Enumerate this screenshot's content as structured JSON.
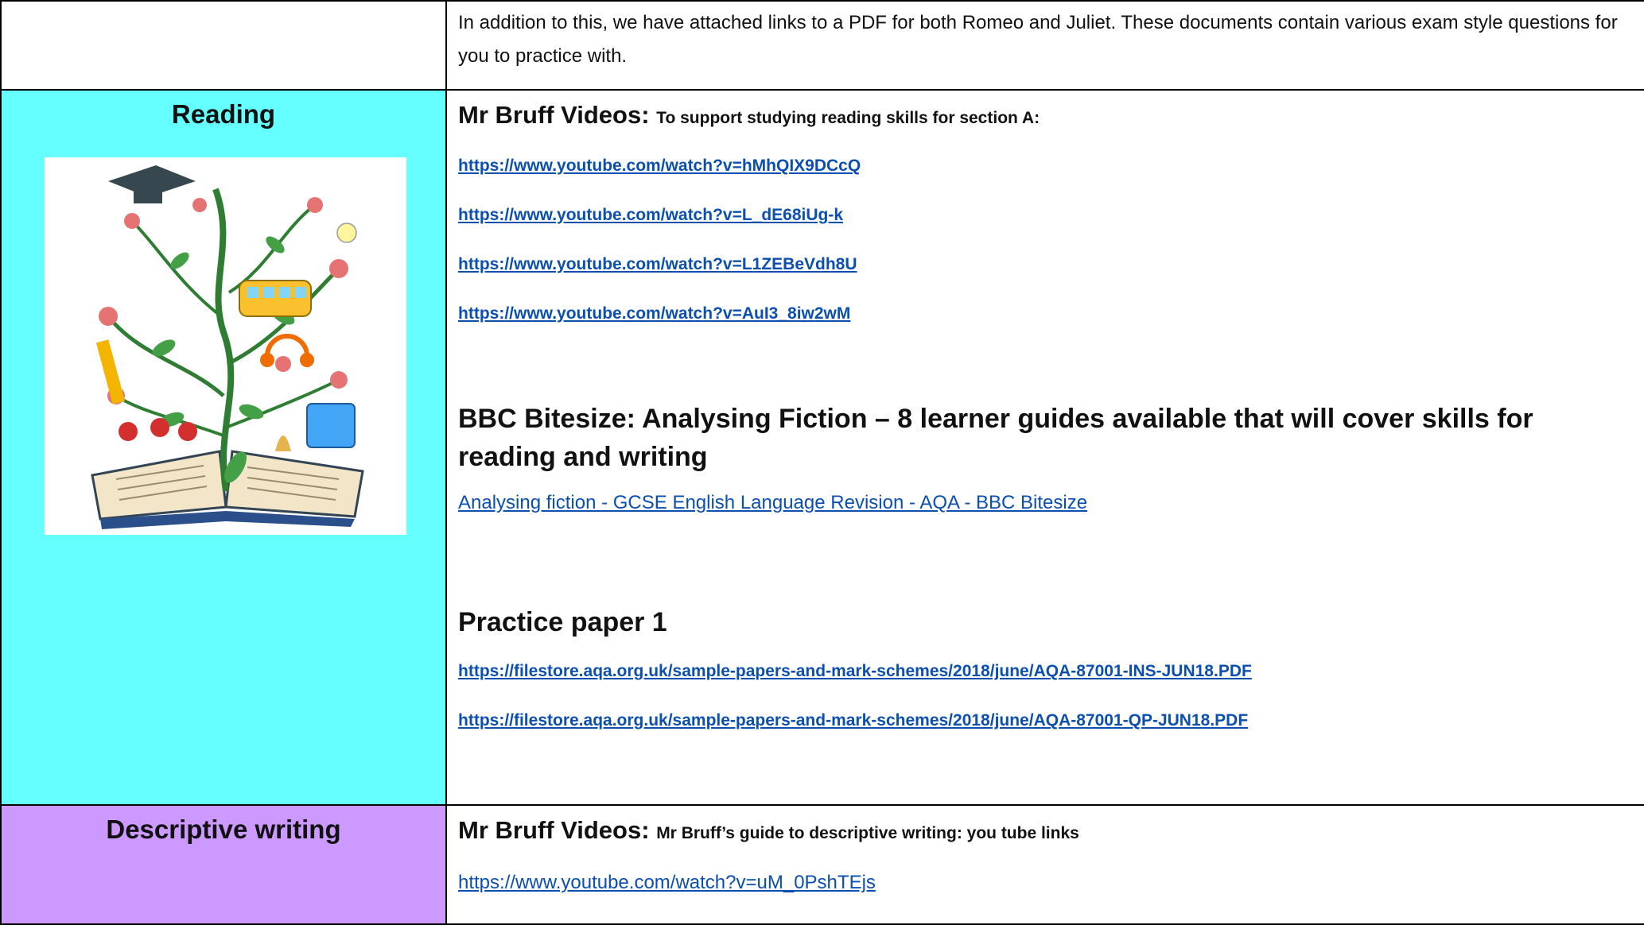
{
  "intro": {
    "text": "In addition to this, we have attached links to a PDF for both Romeo and Juliet. These documents contain various exam style questions for you to practice with."
  },
  "reading": {
    "title": "Reading",
    "image_icon": "book-tree-illustration",
    "bruff_heading": "Mr Bruff Videos:",
    "bruff_sub": "To support studying reading skills for section A:",
    "bruff_links": [
      "https://www.youtube.com/watch?v=hMhQIX9DCcQ",
      "https://www.youtube.com/watch?v=L_dE68iUg-k",
      "https://www.youtube.com/watch?v=L1ZEBeVdh8U",
      "https://www.youtube.com/watch?v=AuI3_8iw2wM"
    ],
    "bbc_heading": "BBC Bitesize: Analysing Fiction – 8 learner guides available that will cover skills for reading and writing",
    "bbc_link": "Analysing fiction - GCSE English Language Revision - AQA - BBC Bitesize",
    "practice_heading": "Practice paper 1",
    "practice_links": [
      "https://filestore.aqa.org.uk/sample-papers-and-mark-schemes/2018/june/AQA-87001-INS-JUN18.PDF",
      "https://filestore.aqa.org.uk/sample-papers-and-mark-schemes/2018/june/AQA-87001-QP-JUN18.PDF"
    ]
  },
  "descriptive": {
    "title": "Descriptive writing",
    "bruff_heading": "Mr Bruff Videos:",
    "bruff_sub": "Mr Bruff’s guide to descriptive writing: you tube links",
    "link": "https://www.youtube.com/watch?v=uM_0PshTEjs"
  },
  "colors": {
    "reading_bg": "#66ffff",
    "descriptive_bg": "#cc99ff",
    "link": "#0b4fb0"
  }
}
